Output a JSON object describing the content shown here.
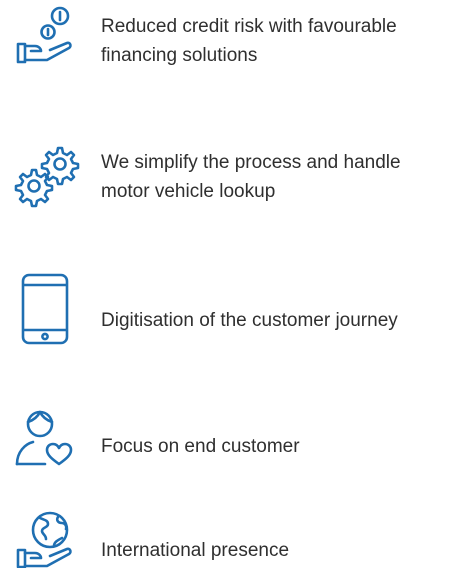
{
  "accent_color": "#1f6fb2",
  "features": [
    {
      "icon": "hand-coin-icon",
      "label": "Reduced credit risk with favourable financing solutions"
    },
    {
      "icon": "gears-icon",
      "label": "We simplify the process and handle motor vehicle lookup"
    },
    {
      "icon": "smartphone-icon",
      "label": "Digitisation of the customer journey"
    },
    {
      "icon": "person-heart-icon",
      "label": "Focus on end customer"
    },
    {
      "icon": "hand-globe-icon",
      "label": "International presence"
    }
  ]
}
